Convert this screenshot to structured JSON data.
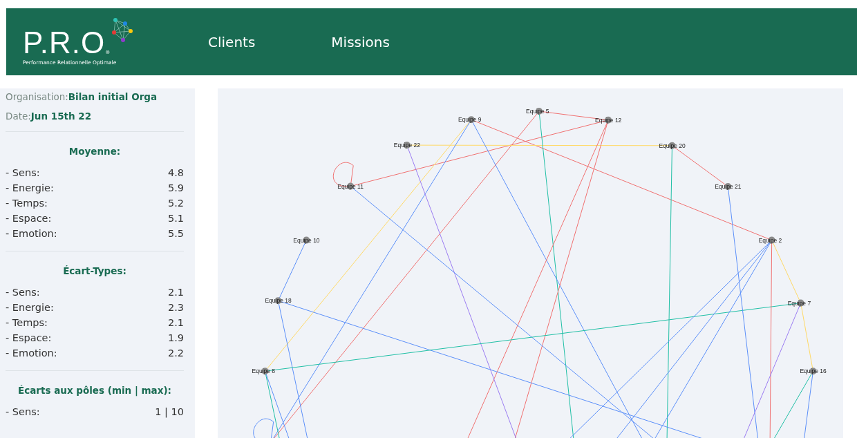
{
  "header": {
    "logo": {
      "wordmark": "P.R.O",
      "registered": "®",
      "tagline": "Performance Relationnelle Optimale"
    },
    "nav": [
      {
        "label": "Clients"
      },
      {
        "label": "Missions"
      }
    ]
  },
  "sidebar": {
    "organisation": {
      "label": "Organisation:",
      "value": "Bilan initial Orga"
    },
    "date": {
      "label": "Date:",
      "value": "Jun 15th 22"
    },
    "sections": [
      {
        "title": "Moyenne:",
        "rows": [
          {
            "label": "- Sens:",
            "value": "4.8"
          },
          {
            "label": "- Energie:",
            "value": "5.9"
          },
          {
            "label": "- Temps:",
            "value": "5.2"
          },
          {
            "label": "- Espace:",
            "value": "5.1"
          },
          {
            "label": "- Emotion:",
            "value": "5.5"
          }
        ]
      },
      {
        "title": "Écart-Types:",
        "rows": [
          {
            "label": "- Sens:",
            "value": "2.1"
          },
          {
            "label": "- Energie:",
            "value": "2.3"
          },
          {
            "label": "- Temps:",
            "value": "2.1"
          },
          {
            "label": "- Espace:",
            "value": "1.9"
          },
          {
            "label": "- Emotion:",
            "value": "2.2"
          }
        ]
      },
      {
        "title": "Écarts aux pôles (min | max):",
        "rows": [
          {
            "label": "- Sens:",
            "value": "1 | 10"
          }
        ]
      }
    ]
  },
  "graph": {
    "nodes": [
      {
        "label": "Equipe 16"
      },
      {
        "label": "Equipe 7"
      },
      {
        "label": "Equipe 2"
      },
      {
        "label": "Equipe 21"
      },
      {
        "label": "Equipe 20"
      },
      {
        "label": "Equipe 12"
      },
      {
        "label": "Equipe 5"
      },
      {
        "label": "Equipe 9"
      },
      {
        "label": "Equipe 22"
      },
      {
        "label": "Equipe 11"
      },
      {
        "label": "Equipe 10"
      },
      {
        "label": "Equipe 18"
      },
      {
        "label": "Equipe 8"
      }
    ]
  }
}
